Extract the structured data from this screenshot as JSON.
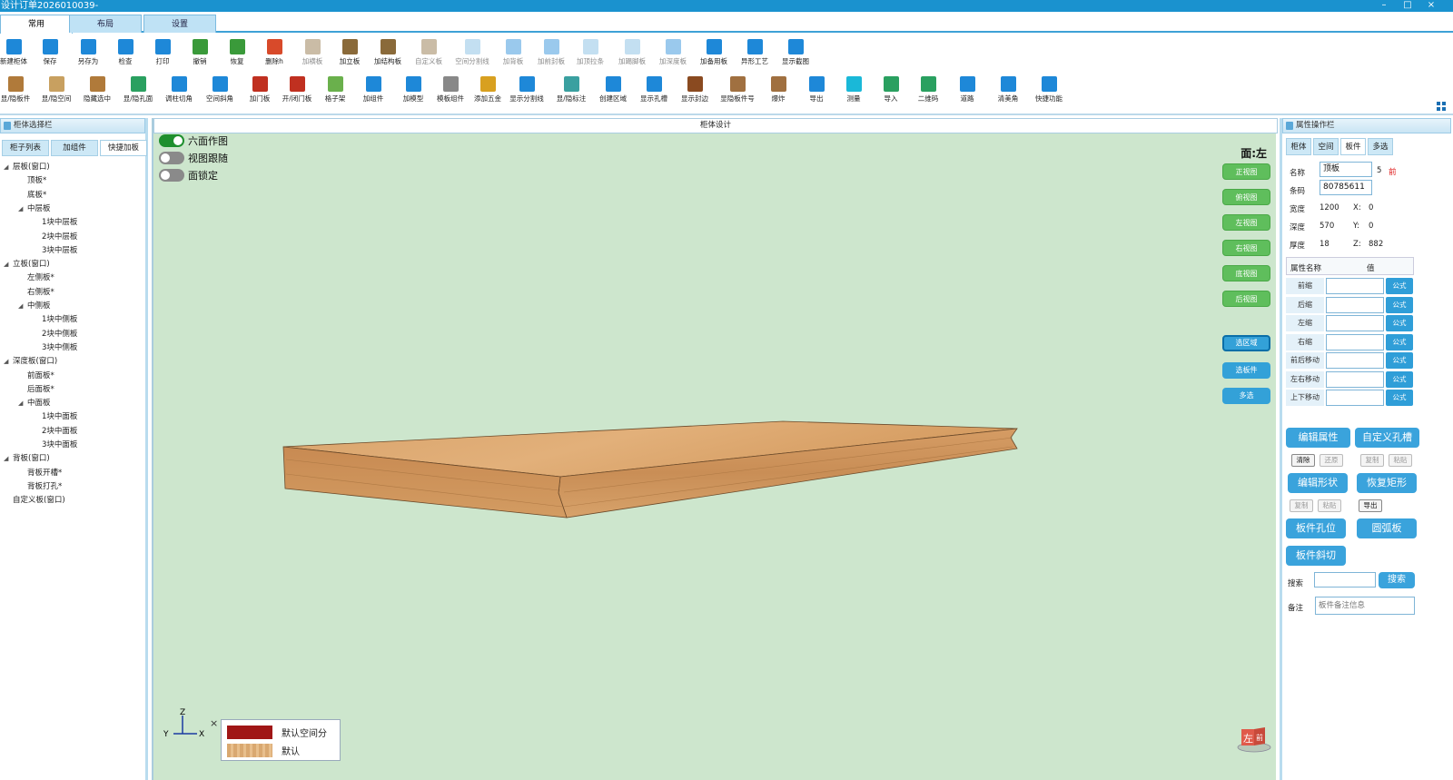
{
  "window": {
    "title": "设计订单2026010039-",
    "controls": [
      "–",
      "□",
      "×"
    ]
  },
  "main_tabs": [
    {
      "label": "常用"
    },
    {
      "label": "布局"
    },
    {
      "label": "设置"
    }
  ],
  "toolbar": {
    "row1": [
      {
        "label": "新建柜体",
        "icon": "new-cabinet-icon",
        "color": "#1e88d8"
      },
      {
        "label": "保存",
        "icon": "save-icon",
        "color": "#1e88d8"
      },
      {
        "label": "另存为",
        "icon": "save-as-icon",
        "color": "#1e88d8"
      },
      {
        "label": "检查",
        "icon": "check-icon",
        "color": "#1e88d8"
      },
      {
        "label": "打印",
        "icon": "print-icon",
        "color": "#1e88d8"
      },
      {
        "label": "撤销",
        "icon": "undo-icon",
        "color": "#3a9a3a"
      },
      {
        "label": "恢复",
        "icon": "redo-icon",
        "color": "#3a9a3a"
      },
      {
        "label": "删除h",
        "icon": "delete-icon",
        "color": "#d84a2a"
      },
      {
        "label": "加横板",
        "icon": "add-horizontal-board-icon",
        "color": "#8a6a3a"
      },
      {
        "label": "加立板",
        "icon": "add-vertical-board-icon",
        "color": "#8a6a3a"
      },
      {
        "label": "加结构板",
        "icon": "add-structure-board-icon",
        "color": "#8a6a3a"
      },
      {
        "label": "自定义板",
        "icon": "custom-board-icon",
        "color": "#8a6a3a"
      },
      {
        "label": "空间分割线",
        "icon": "space-divider-icon",
        "color": "#7ab8e0"
      },
      {
        "label": "加背板",
        "icon": "add-back-board-icon",
        "color": "#1e88d8"
      },
      {
        "label": "加前封板",
        "icon": "add-front-seal-icon",
        "color": "#1e88d8"
      },
      {
        "label": "加顶拉条",
        "icon": "add-top-strip-icon",
        "color": "#7ab8e0"
      },
      {
        "label": "加踢脚板",
        "icon": "add-skirting-icon",
        "color": "#7ab8e0"
      },
      {
        "label": "加深度板",
        "icon": "add-depth-board-icon",
        "color": "#1e88d8"
      },
      {
        "label": "加备用板",
        "icon": "add-spare-board-icon",
        "color": "#1e88d8"
      },
      {
        "label": "异形工艺",
        "icon": "special-shape-icon",
        "color": "#1e88d8"
      },
      {
        "label": "显示截图",
        "icon": "screenshot-icon",
        "color": "#1e88d8"
      }
    ],
    "row2": [
      {
        "label": "显/隐板件",
        "icon": "toggle-panels-icon",
        "color": "#b07a3a"
      },
      {
        "label": "显/隐空间",
        "icon": "toggle-space-icon",
        "color": "#c8a060"
      },
      {
        "label": "隐藏选中",
        "icon": "hide-selected-icon",
        "color": "#b07a3a"
      },
      {
        "label": "显/隐孔面",
        "icon": "toggle-holes-icon",
        "color": "#2aa060"
      },
      {
        "label": "调柱切角",
        "icon": "column-cut-icon",
        "color": "#1e88d8"
      },
      {
        "label": "空间斜角",
        "icon": "space-bevel-icon",
        "color": "#1e88d8"
      },
      {
        "label": "加门板",
        "icon": "add-door-icon",
        "color": "#c03020"
      },
      {
        "label": "开/闭门板",
        "icon": "open-close-door-icon",
        "color": "#c03020"
      },
      {
        "label": "格子架",
        "icon": "grid-rack-icon",
        "color": "#6ab04c"
      },
      {
        "label": "加组件",
        "icon": "add-component-icon",
        "color": "#1e88d8"
      },
      {
        "label": "加模型",
        "icon": "add-model-icon",
        "color": "#1e88d8"
      },
      {
        "label": "模板组件",
        "icon": "template-component-icon",
        "color": "#888888"
      },
      {
        "label": "添加五金",
        "icon": "add-hardware-icon",
        "color": "#d8a020"
      },
      {
        "label": "显示分割线",
        "icon": "show-divider-icon",
        "color": "#1e88d8"
      },
      {
        "label": "显/隐标注",
        "icon": "toggle-dimension-icon",
        "color": "#3aa0a0"
      },
      {
        "label": "创建区域",
        "icon": "create-region-icon",
        "color": "#1e88d8"
      },
      {
        "label": "显示孔槽",
        "icon": "show-slots-icon",
        "color": "#1e88d8"
      },
      {
        "label": "显示封边",
        "icon": "show-edge-icon",
        "color": "#8a4a20"
      },
      {
        "label": "显隐板件号",
        "icon": "toggle-panel-number-icon",
        "color": "#a07040"
      },
      {
        "label": "爆炸",
        "icon": "explode-icon",
        "color": "#a07040"
      },
      {
        "label": "导出",
        "icon": "export-icon",
        "color": "#1e88d8"
      },
      {
        "label": "测量",
        "icon": "measure-icon",
        "color": "#1ab8d8"
      },
      {
        "label": "导入",
        "icon": "import-icon",
        "color": "#2aa060"
      },
      {
        "label": "二维码",
        "icon": "qr-code-icon",
        "color": "#2aa060"
      },
      {
        "label": "道路",
        "icon": "route-icon",
        "color": "#1e88d8"
      },
      {
        "label": "清美角",
        "icon": "clear-corner-icon",
        "color": "#1e88d8"
      },
      {
        "label": "快捷功能",
        "icon": "quick-function-icon",
        "color": "#1e88d8"
      }
    ]
  },
  "left_panel": {
    "title": "柜体选择栏",
    "tabs": [
      {
        "label": "柜子列表"
      },
      {
        "label": "加组件"
      },
      {
        "label": "快捷加板"
      }
    ],
    "tree": [
      {
        "label": "层板(窗口)",
        "level": 0,
        "expander": "◢"
      },
      {
        "label": "顶板*",
        "level": 1,
        "expander": ""
      },
      {
        "label": "底板*",
        "level": 1,
        "expander": ""
      },
      {
        "label": "中层板",
        "level": 1,
        "expander": "◢"
      },
      {
        "label": "1块中层板",
        "level": 2,
        "expander": ""
      },
      {
        "label": "2块中层板",
        "level": 2,
        "expander": ""
      },
      {
        "label": "3块中层板",
        "level": 2,
        "expander": ""
      },
      {
        "label": "立板(窗口)",
        "level": 0,
        "expander": "◢"
      },
      {
        "label": "左侧板*",
        "level": 1,
        "expander": ""
      },
      {
        "label": "右侧板*",
        "level": 1,
        "expander": ""
      },
      {
        "label": "中侧板",
        "level": 1,
        "expander": "◢"
      },
      {
        "label": "1块中侧板",
        "level": 2,
        "expander": ""
      },
      {
        "label": "2块中侧板",
        "level": 2,
        "expander": ""
      },
      {
        "label": "3块中侧板",
        "level": 2,
        "expander": ""
      },
      {
        "label": "深度板(窗口)",
        "level": 0,
        "expander": "◢"
      },
      {
        "label": "前面板*",
        "level": 1,
        "expander": ""
      },
      {
        "label": "后面板*",
        "level": 1,
        "expander": ""
      },
      {
        "label": "中面板",
        "level": 1,
        "expander": "◢"
      },
      {
        "label": "1块中面板",
        "level": 2,
        "expander": ""
      },
      {
        "label": "2块中面板",
        "level": 2,
        "expander": ""
      },
      {
        "label": "3块中面板",
        "level": 2,
        "expander": ""
      },
      {
        "label": "背板(窗口)",
        "level": 0,
        "expander": "◢"
      },
      {
        "label": "背板开槽*",
        "level": 1,
        "expander": ""
      },
      {
        "label": "背板打孔*",
        "level": 1,
        "expander": ""
      },
      {
        "label": "自定义板(窗口)",
        "level": 0,
        "expander": ""
      }
    ]
  },
  "center": {
    "title": "柜体设计",
    "toggles": [
      {
        "label": "六面作图",
        "on": true
      },
      {
        "label": "视图跟随",
        "on": false
      },
      {
        "label": "面锁定",
        "on": false
      }
    ],
    "face_label": "面:左",
    "view_buttons": [
      {
        "label": "正视图"
      },
      {
        "label": "俯视图"
      },
      {
        "label": "左视图"
      },
      {
        "label": "右视图"
      },
      {
        "label": "底视图"
      },
      {
        "label": "后视图"
      }
    ],
    "select_buttons": [
      {
        "label": "选区域",
        "selected": true
      },
      {
        "label": "选板件",
        "selected": false
      },
      {
        "label": "多选",
        "selected": false
      }
    ],
    "axis": {
      "z": "Z",
      "y": "Y",
      "x": "X"
    },
    "legend_close": "×",
    "legend": [
      {
        "label": "默认空间分",
        "color": "#a01616"
      },
      {
        "label": "默认",
        "color": "#d9a870"
      }
    ],
    "cube_labels": {
      "left": "左",
      "front": "前"
    }
  },
  "right_panel": {
    "title": "属性操作栏",
    "tabs": [
      {
        "label": "柜体"
      },
      {
        "label": "空间"
      },
      {
        "label": "板件",
        "active": true
      },
      {
        "label": "多选"
      }
    ],
    "name_label": "名称",
    "name_value": "顶板",
    "name_num": "5",
    "name_tag": "前",
    "barcode_label": "条码",
    "barcode_value": "80785611",
    "dims": [
      {
        "label": "宽度",
        "value": "1200",
        "axis": "X:",
        "axis_value": "0"
      },
      {
        "label": "深度",
        "value": "570",
        "axis": "Y:",
        "axis_value": "0"
      },
      {
        "label": "厚度",
        "value": "18",
        "axis": "Z:",
        "axis_value": "882"
      }
    ],
    "prop_header": {
      "name": "属性名称",
      "value": "值"
    },
    "props": [
      {
        "label": "前缩",
        "btn": "公式"
      },
      {
        "label": "后缩",
        "btn": "公式"
      },
      {
        "label": "左缩",
        "btn": "公式"
      },
      {
        "label": "右缩",
        "btn": "公式"
      },
      {
        "label": "前后移动",
        "btn": "公式"
      },
      {
        "label": "左右移动",
        "btn": "公式"
      },
      {
        "label": "上下移动",
        "btn": "公式"
      }
    ],
    "btn_edit_props": "编辑属性",
    "btn_custom_slot": "自定义孔槽",
    "small1": [
      "清除",
      "还原",
      "复制",
      "粘贴"
    ],
    "btn_edit_shape": "编辑形状",
    "btn_restore_rect": "恢复矩形",
    "small2": [
      "复制",
      "粘贴",
      "导出"
    ],
    "btn_hole": "板件孔位",
    "btn_arc": "圆弧板",
    "btn_bevel": "板件斜切",
    "search_label": "搜索",
    "search_value": "",
    "search_btn": "搜索",
    "note_label": "备注",
    "note_placeholder": "板件备注信息"
  }
}
